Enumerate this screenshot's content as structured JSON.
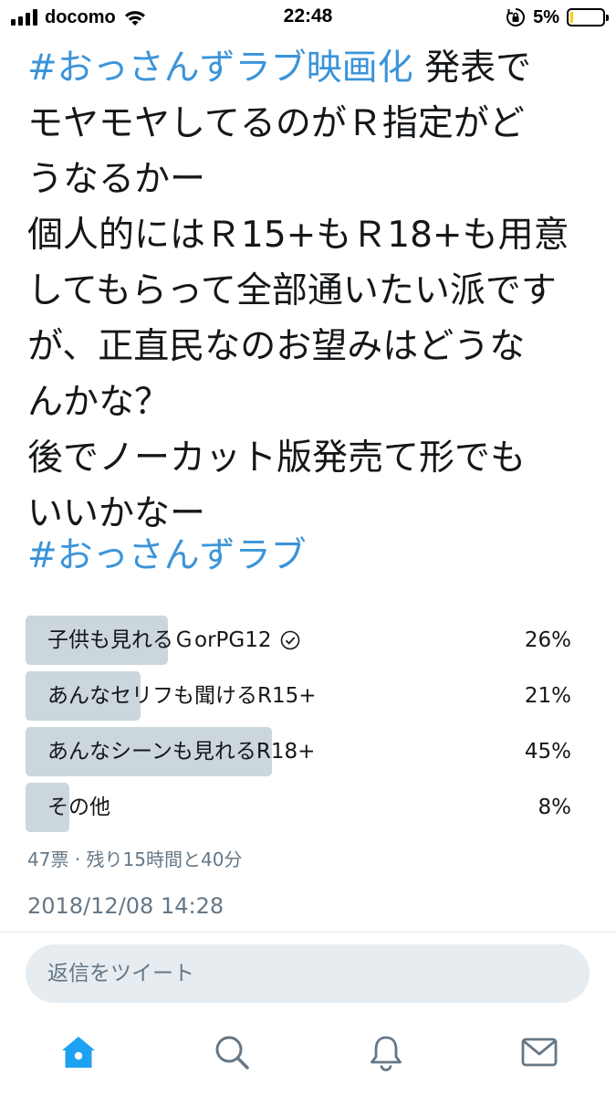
{
  "status_bar": {
    "carrier": "docomo",
    "time": "22:48",
    "battery_percent": "5%",
    "battery_level": 0.05,
    "icons": [
      "signal-icon",
      "wifi-icon",
      "rotation-lock-icon",
      "battery-icon"
    ]
  },
  "tweet": {
    "lines": [
      {
        "hashtag": "#おっさんずラブ映画化",
        "text": " 発表で"
      },
      {
        "text": "モヤモヤしてるのがＲ指定がど"
      },
      {
        "text": "うなるかー"
      },
      {
        "text": "個人的にはＲ15+もＲ18+も用意"
      },
      {
        "text": "してもらって全部通いたい派ですが、正直民なのお望みはどうなんかな？"
      }
    ],
    "text_lines": [
      "モヤモヤしてるのがＲ指定がど",
      "うなるかー",
      "個人的にはＲ15+もＲ18+も用意",
      "してもらって全部通いたい派です",
      "が、正直民なのお望みはどうな",
      "んかな？",
      "後でノーカット版発売て形でも",
      "いいかなー"
    ],
    "first_hashtag": "#おっさんずラブ映画化",
    "first_text": " 発表で",
    "footer_hashtag": "#おっさんずラブ"
  },
  "poll": {
    "options": [
      {
        "label": "子供も見れるＧorPG12",
        "percent": "26%",
        "value": 26,
        "selected": true
      },
      {
        "label": "あんなセリフも聞けるR15+",
        "percent": "21%",
        "value": 21,
        "selected": false
      },
      {
        "label": "あんなシーンも見れるR18+",
        "percent": "45%",
        "value": 45,
        "selected": false
      },
      {
        "label": "その他",
        "percent": "8%",
        "value": 8,
        "selected": false
      }
    ],
    "meta": "47票 · 残り15時間と40分"
  },
  "timestamp": "2018/12/08 14:28",
  "reply": {
    "placeholder": "返信をツイート"
  },
  "tab_bar": {
    "tabs": [
      "home-icon",
      "search-icon",
      "notifications-icon",
      "messages-icon"
    ],
    "active_color": "#1da1f2",
    "inactive_color": "#657786"
  },
  "colors": {
    "hashtag": "#3b94d9",
    "poll_bar": "#ccd6dd",
    "muted_text": "#657786"
  }
}
